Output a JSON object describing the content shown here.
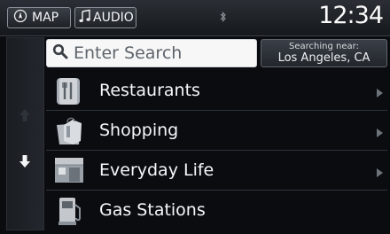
{
  "topbar": {
    "map_label": "MAP",
    "audio_label": "AUDIO",
    "bluetooth_glyph": "ʙ",
    "clock": "12:34"
  },
  "search": {
    "placeholder": "Enter Search",
    "near_label": "Searching near:",
    "near_value": "Los Angeles, CA"
  },
  "categories": [
    {
      "label": "Restaurants",
      "icon": "restaurant-icon"
    },
    {
      "label": "Shopping",
      "icon": "shopping-bag-icon"
    },
    {
      "label": "Everyday Life",
      "icon": "everyday-life-icon"
    },
    {
      "label": "Gas Stations",
      "icon": "gas-pump-icon"
    }
  ]
}
